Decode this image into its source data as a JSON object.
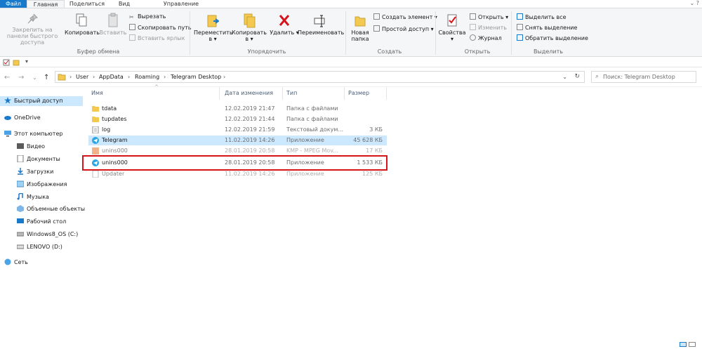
{
  "tabs": {
    "file": "Файл",
    "home": "Главная",
    "share": "Поделиться",
    "view": "Вид",
    "manage": "Управление"
  },
  "ribbon": {
    "pin": "Закрепить на панели быстрого доступа",
    "copy": "Копировать",
    "paste": "Вставить",
    "cut": "Вырезать",
    "copy_path": "Скопировать путь",
    "paste_shortcut": "Вставить ярлык",
    "move_to": "Переместить в",
    "copy_to": "Копировать в",
    "delete": "Удалить",
    "rename": "Переименовать",
    "new_folder": "Новая папка",
    "new_item": "Создать элемент",
    "easy_access": "Простой доступ",
    "properties": "Свойства",
    "open": "Открыть",
    "edit": "Изменить",
    "history": "Журнал",
    "select_all": "Выделить все",
    "select_none": "Снять выделение",
    "invert_selection": "Обратить выделение",
    "groups": {
      "clipboard": "Буфер обмена",
      "organize": "Упорядочить",
      "new": "Создать",
      "open": "Открыть",
      "select": "Выделить"
    }
  },
  "address": {
    "crumbs": [
      "User",
      "AppData",
      "Roaming",
      "Telegram Desktop"
    ],
    "search_placeholder": "Поиск: Telegram Desktop"
  },
  "nav": {
    "quick_access": "Быстрый доступ",
    "onedrive": "OneDrive",
    "this_pc": "Этот компьютер",
    "video": "Видео",
    "documents": "Документы",
    "downloads": "Загрузки",
    "images": "Изображения",
    "music": "Музыка",
    "objects": "Объемные объекты",
    "desktop": "Рабочий стол",
    "drive_c": "Windows8_OS (C:)",
    "drive_d": "LENOVO (D:)",
    "network": "Сеть"
  },
  "columns": {
    "name": "Имя",
    "date": "Дата изменения",
    "type": "Тип",
    "size": "Размер"
  },
  "files": [
    {
      "name": "tdata",
      "date": "12.02.2019 21:47",
      "type": "Папка с файлами",
      "size": ""
    },
    {
      "name": "tupdates",
      "date": "12.02.2019 21:44",
      "type": "Папка с файлами",
      "size": ""
    },
    {
      "name": "log",
      "date": "12.02.2019 21:59",
      "type": "Текстовый докум...",
      "size": "3 КБ"
    },
    {
      "name": "Telegram",
      "date": "11.02.2019 14:26",
      "type": "Приложение",
      "size": "45 628 КБ"
    },
    {
      "name": "unins000",
      "date": "28.01.2019 20:58",
      "type": "KMP - MPEG Mov...",
      "size": "17 КБ"
    },
    {
      "name": "unins000",
      "date": "28.01.2019 20:58",
      "type": "Приложение",
      "size": "1 533 КБ"
    },
    {
      "name": "Updater",
      "date": "11.02.2019 14:26",
      "type": "Приложение",
      "size": "125 КБ"
    }
  ],
  "colors": {
    "accent": "#1979ca",
    "selection": "#cce8ff",
    "highlight_border": "#d6141c",
    "folder": "#f3c94f"
  }
}
